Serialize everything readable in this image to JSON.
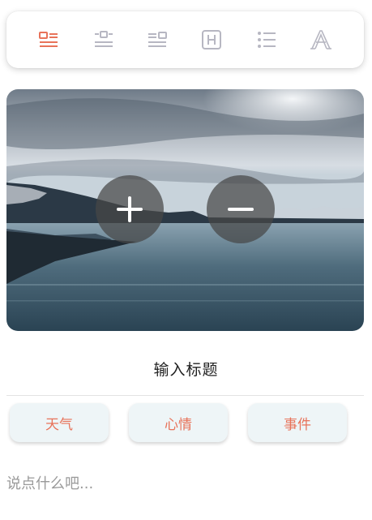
{
  "toolbar": {
    "tools": [
      {
        "icon": "image-left-text-icon",
        "active": true
      },
      {
        "icon": "image-center-text-icon",
        "active": false
      },
      {
        "icon": "image-right-text-icon",
        "active": false
      },
      {
        "icon": "heading-icon",
        "active": false,
        "glyph": "H"
      },
      {
        "icon": "list-icon",
        "active": false
      },
      {
        "icon": "font-style-icon",
        "active": false,
        "glyph": "A"
      }
    ],
    "active_color": "#e8735a",
    "inactive_color": "#b7b7c2"
  },
  "photo": {
    "zoom_in_label": "+",
    "zoom_out_label": "−"
  },
  "editor": {
    "title": "输入标题",
    "tags": [
      "天气",
      "心情",
      "事件"
    ],
    "note_placeholder": "说点什么吧..."
  }
}
